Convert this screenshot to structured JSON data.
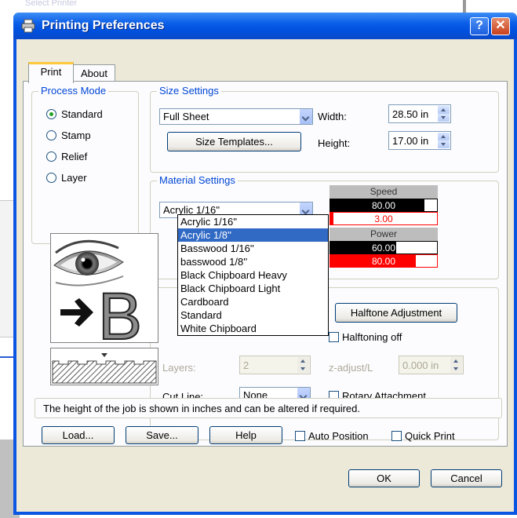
{
  "background": {
    "title_fragment": "Select Printer"
  },
  "window": {
    "title": "Printing Preferences",
    "help_glyph": "?",
    "close_glyph": "✕"
  },
  "tabs": [
    {
      "label": "Print",
      "active": true
    },
    {
      "label": "About",
      "active": false
    }
  ],
  "process_mode": {
    "legend": "Process Mode",
    "options": [
      {
        "label": "Standard",
        "selected": true
      },
      {
        "label": "Stamp",
        "selected": false
      },
      {
        "label": "Relief",
        "selected": false
      },
      {
        "label": "Layer",
        "selected": false
      }
    ]
  },
  "size_settings": {
    "legend": "Size Settings",
    "sheet_value": "Full Sheet",
    "templates_button": "Size Templates...",
    "width_label": "Width:",
    "width_value": "28.50 in",
    "height_label": "Height:",
    "height_value": "17.00 in"
  },
  "material_settings": {
    "legend": "Material Settings",
    "selected": "Acrylic 1/16''",
    "options": [
      "Acrylic 1/16''",
      "Acrylic 1/8''",
      "Basswood 1/16''",
      "basswood 1/8''",
      "Black Chipboard Heavy",
      "Black Chipboard Light",
      "Cardboard",
      "Standard",
      "White Chipboard"
    ],
    "highlighted_index": 1,
    "speed_label": "Speed",
    "speed_value_1": "80.00",
    "speed_value_2": "3.00",
    "power_label": "Power",
    "power_value_1": "60.00",
    "power_value_2": "80.00",
    "speed_fill_1": 0.88,
    "speed_fill_2": 0.03,
    "power_fill_1": 0.62,
    "power_fill_2": 0.8
  },
  "lower_group": {
    "halftone_button": "Halftone Adjustment",
    "halftoning_off": "Halftoning off",
    "layers_label": "Layers:",
    "layers_value": "2",
    "zadjust_label": "z-adjust/L",
    "zadjust_value": "0.000 in",
    "cutline_label": "Cut Line:",
    "cutline_value": "None",
    "rotary_label": "Rotary Attachment"
  },
  "status_text": "The height of the job is shown in inches and can be altered if required.",
  "bottom_buttons": {
    "load": "Load...",
    "save": "Save...",
    "help": "Help",
    "auto_position": "Auto Position",
    "quick_print": "Quick Print",
    "ok": "OK",
    "cancel": "Cancel"
  },
  "colors": {
    "title_blue": "#0a55e3",
    "legend_blue": "#0046d5",
    "list_highlight": "#316ac5",
    "power_red": "#ff0000"
  }
}
